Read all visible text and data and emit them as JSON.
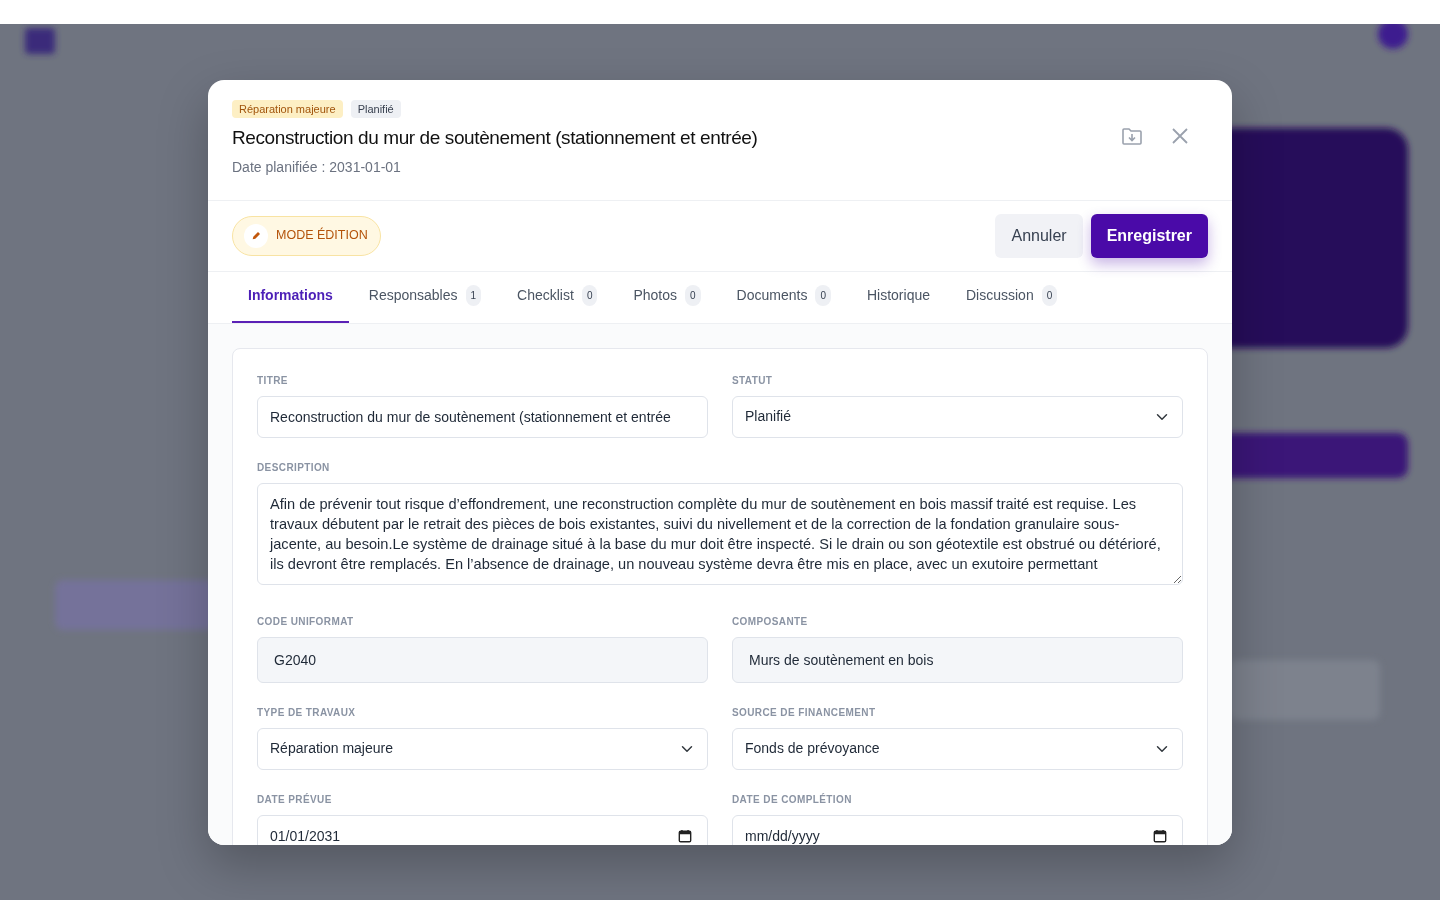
{
  "modal": {
    "badges": [
      {
        "label": "Réparation majeure",
        "kind": "type"
      },
      {
        "label": "Planifié",
        "kind": "status"
      }
    ],
    "title": "Reconstruction du mur de soutènement (stationnement et entrée)",
    "subtitle": "Date planifiée : 2031-01-01",
    "mode_pill": "MODE ÉDITION",
    "buttons": [
      {
        "label": "Annuler",
        "kind": "secondary"
      },
      {
        "label": "Enregistrer",
        "kind": "primary"
      }
    ],
    "tabs": [
      {
        "label": "Informations",
        "selected": true
      },
      {
        "label": "Responsables",
        "count": "1",
        "selected": false
      },
      {
        "label": "Checklist",
        "count": "0",
        "selected": false
      },
      {
        "label": "Photos",
        "count": "0",
        "selected": false
      },
      {
        "label": "Documents",
        "count": "0",
        "selected": false
      },
      {
        "label": "Historique",
        "selected": false
      },
      {
        "label": "Discussion",
        "count": "0",
        "selected": false
      }
    ],
    "form": [
      {
        "label": "TITRE",
        "kind": "text",
        "value": "Reconstruction du mur de soutènement (stationnement et entrée"
      },
      {
        "label": "STATUT",
        "kind": "select",
        "value": "Planifié"
      },
      {
        "label": "DESCRIPTION",
        "kind": "textarea",
        "value": "Afin de prévenir tout risque d’effondrement, une reconstruction complète du mur de soutènement en bois massif traité est requise. Les travaux débutent par le retrait des pièces de bois existantes, suivi du nivellement et de la correction de la fondation granulaire sous-jacente, au besoin.Le système de drainage situé à la base du mur doit être inspecté. Si le drain ou son géotextile est obstrué ou détérioré, ils devront être remplacés. En l’absence de drainage, un nouveau système devra être mis en place, avec un exutoire permettant"
      },
      {
        "label": "CODE UNIFORMAT",
        "kind": "readonly",
        "value": "G2040"
      },
      {
        "label": "COMPOSANTE",
        "kind": "readonly",
        "value": "Murs de soutènement en bois"
      },
      {
        "label": "TYPE DE TRAVAUX",
        "kind": "select",
        "value": "Réparation majeure"
      },
      {
        "label": "SOURCE DE FINANCEMENT",
        "kind": "select",
        "value": "Fonds de prévoyance"
      },
      {
        "label": "DATE PRÉVUE",
        "kind": "date",
        "value": "01/01/2031"
      },
      {
        "label": "DATE DE COMPLÉTION",
        "kind": "date",
        "placeholder": "mm/dd/yyyy"
      }
    ]
  }
}
